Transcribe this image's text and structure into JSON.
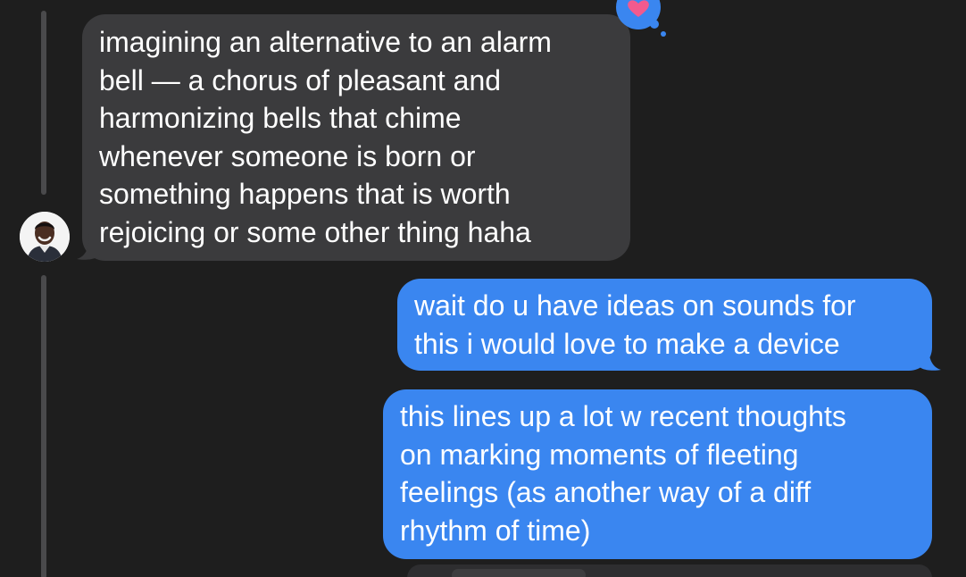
{
  "conversation": {
    "incoming_message": {
      "text": "imagining an alternative to an alarm\nbell — a chorus of pleasant and\nharmonizing bells that chime\nwhenever someone is born or\nsomething happens that is worth\nrejoicing or some other thing haha",
      "tapback": "heart-icon"
    },
    "outgoing_messages": [
      {
        "text": "wait do u have ideas on sounds for\nthis i would love to make a device"
      },
      {
        "text": "this lines up a lot w recent thoughts\non marking moments of fleeting\nfeelings (as another way of a diff\nrhythm of time)"
      }
    ]
  },
  "colors": {
    "background": "#1e1e1e",
    "incoming_bubble": "#3b3b3d",
    "outgoing_bubble": "#3a86f0",
    "tapback_bubble": "#3a86f0",
    "heart": "#f25a8e",
    "thread_line": "#4a4a4c"
  }
}
